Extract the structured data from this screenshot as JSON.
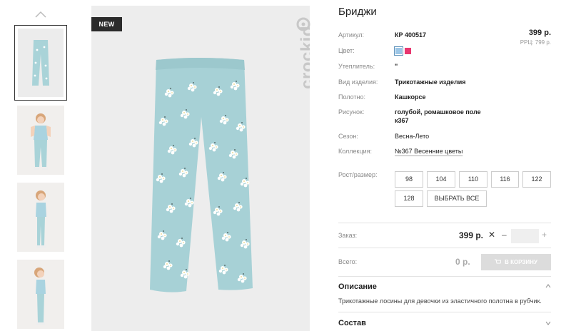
{
  "gallery": {
    "up_icon": "chevron-up-icon",
    "thumbnails": [
      {
        "alt": "leggings-flat"
      },
      {
        "alt": "girl-front"
      },
      {
        "alt": "girl-side"
      },
      {
        "alt": "girl-profile"
      }
    ],
    "badge": "NEW",
    "brand": "crockid"
  },
  "product": {
    "title": "Бриджи",
    "price": "399 р.",
    "price_rrc": "РРЦ: 799 р.",
    "fields": {
      "article_label": "Артикул:",
      "article_value": "КР 400517",
      "color_label": "Цвет:",
      "insulation_label": "Утеплитель:",
      "insulation_value": "\"",
      "type_label": "Вид изделия:",
      "type_value": "Трикотажные изделия",
      "fabric_label": "Полотно:",
      "fabric_value": "Кашкорсе",
      "pattern_label": "Рисунок:",
      "pattern_value_1": "голубой, ромашковое поле",
      "pattern_value_2": "к367",
      "season_label": "Сезон:",
      "season_value": "Весна-Лето",
      "collection_label": "Коллекция:",
      "collection_value": "№367 Весенние цветы"
    },
    "colors": [
      "#9cc6e6",
      "#e8366f"
    ],
    "size_label": "Рост/размер:",
    "sizes": [
      "98",
      "104",
      "110",
      "116",
      "122",
      "128"
    ],
    "select_all": "ВЫБРАТЬ ВСЕ"
  },
  "order": {
    "label": "Заказ:",
    "price": "399 р.",
    "x": "✕",
    "minus": "–",
    "plus": "+",
    "qty": ""
  },
  "total": {
    "label": "Всего:",
    "value": "0 р.",
    "cart_button": "В КОРЗИНУ"
  },
  "sections": {
    "description_title": "Описание",
    "description_text": "Трикотажные лосины для девочки из эластичного полотна в рубчик.",
    "composition_title": "Состав"
  }
}
